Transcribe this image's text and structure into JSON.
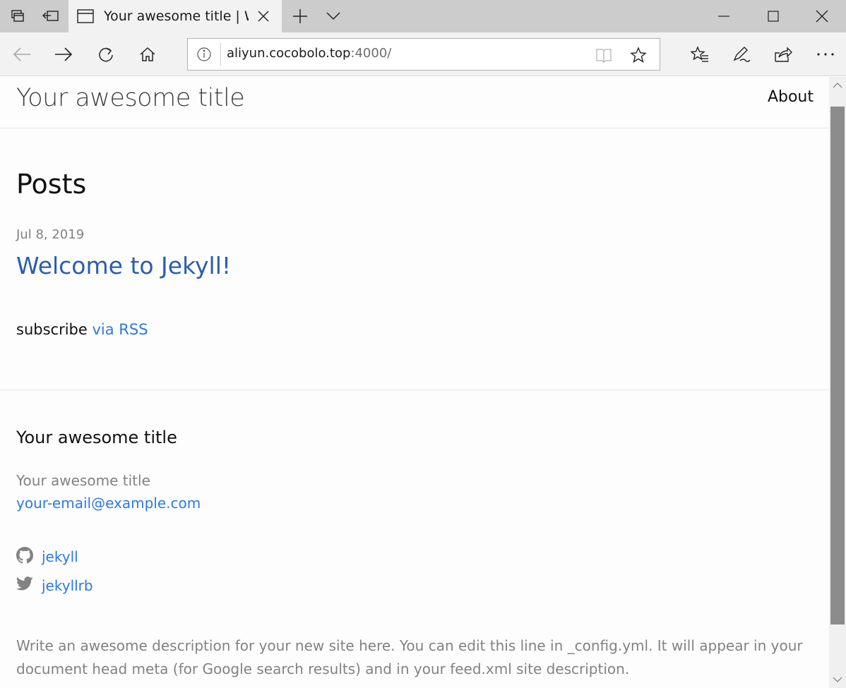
{
  "browser": {
    "tab": {
      "title": "Your awesome title | Wr"
    },
    "address": {
      "host": "aliyun.cocobolo.top",
      "port": ":4000/"
    },
    "icons": {
      "tab_manager": "tab-manager-icon",
      "set_aside": "set-aside-tabs-icon",
      "tab_page": "tab-page-icon",
      "close_tab": "close-icon",
      "new_tab": "plus-icon",
      "tab_preview": "chevron-down-icon",
      "minimize": "minimize-icon",
      "maximize": "maximize-icon",
      "close_window": "close-icon",
      "back": "back-arrow-icon",
      "forward": "forward-arrow-icon",
      "refresh": "refresh-icon",
      "home": "home-icon",
      "site_info": "info-icon",
      "reading_view": "book-icon",
      "favorite": "star-icon",
      "favorites_hub": "favorites-icon",
      "web_note": "pen-icon",
      "share": "share-icon",
      "more": "more-icon"
    }
  },
  "page": {
    "site_title": "Your awesome title",
    "nav": {
      "about": "About"
    },
    "posts_heading": "Posts",
    "posts": [
      {
        "date": "Jul 8, 2019",
        "title": "Welcome to Jekyll!"
      }
    ],
    "subscribe": {
      "prefix": "subscribe ",
      "link": "via RSS"
    },
    "footer": {
      "heading": "Your awesome title",
      "name": "Your awesome title",
      "email": "your-email@example.com",
      "social": [
        {
          "icon": "github-icon",
          "label": "jekyll"
        },
        {
          "icon": "twitter-icon",
          "label": "jekyllrb"
        }
      ],
      "description": "Write an awesome description for your new site here. You can edit this line in _config.yml. It will appear in your document head meta (for Google search results) and in your feed.xml site description."
    }
  },
  "colors": {
    "link": "#2a7ae2",
    "post_link": "#2a5db0",
    "muted": "#828282",
    "chrome": "#cccccc",
    "chrome_active": "#f2f2f2",
    "scroll_thumb": "#8c8c8c"
  }
}
